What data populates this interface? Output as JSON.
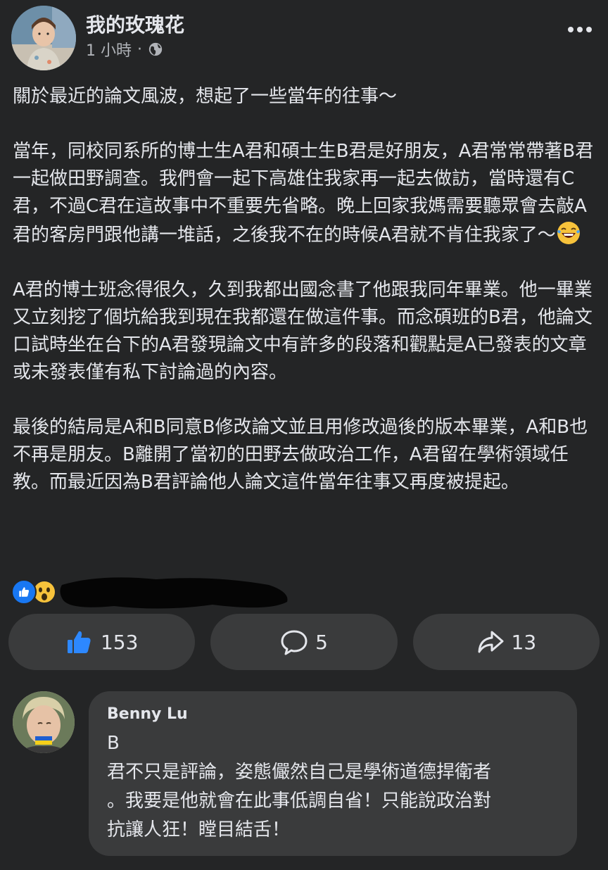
{
  "post": {
    "author": "我的玫瑰花",
    "time": "1 小時",
    "separator": "·",
    "privacy_icon": "globe-icon",
    "more_icon": "more-dots-icon",
    "paragraphs": [
      "關於最近的論文風波，想起了一些當年的往事～",
      "當年，同校同系所的博士生A君和碩士生B君是好朋友，A君常常帶著B君一起做田野調查。我們會一起下高雄住我家再一起去做訪，當時還有C君，不過C君在這故事中不重要先省略。晚上回家我媽需要聽眾會去敲A君的客房門跟他講一堆話，之後我不在的時候A君就不肯住我家了～",
      "A君的博士班念得很久，久到我都出國念書了他跟我同年畢業。他一畢業又立刻挖了個坑給我到現在我都還在做這件事。而念碩班的B君，他論文口試時坐在台下的A君發現論文中有許多的段落和觀點是A已發表的文章或未發表僅有私下討論過的內容。",
      "最後的結局是A和B同意B修改論文並且用修改過後的版本畢業，A和B也不再是朋友。B離開了當初的田野去做政治工作，A君留在學術領域任教。而最近因為B君評論他人論文這件當年往事又再度被提起。"
    ],
    "emoji_name": "laughing-tears-emoji"
  },
  "reactions": {
    "types": [
      "like-reaction-icon",
      "wow-reaction-icon"
    ],
    "summary_redacted": true
  },
  "actions": {
    "like_count": "153",
    "comment_count": "5",
    "share_count": "13"
  },
  "comment": {
    "author": "Benny Lu",
    "lines": [
      "B",
      "君不只是評論，姿態儼然自己是學術道德捍衛者",
      "。我要是他就會在此事低調自省！只能說政治對",
      "抗讓人狂！瞠目結舌！"
    ]
  },
  "colors": {
    "background": "#242526",
    "surface": "#3a3b3c",
    "text": "#e4e6eb",
    "secondary_text": "#b0b3b8",
    "accent": "#1877f2"
  }
}
